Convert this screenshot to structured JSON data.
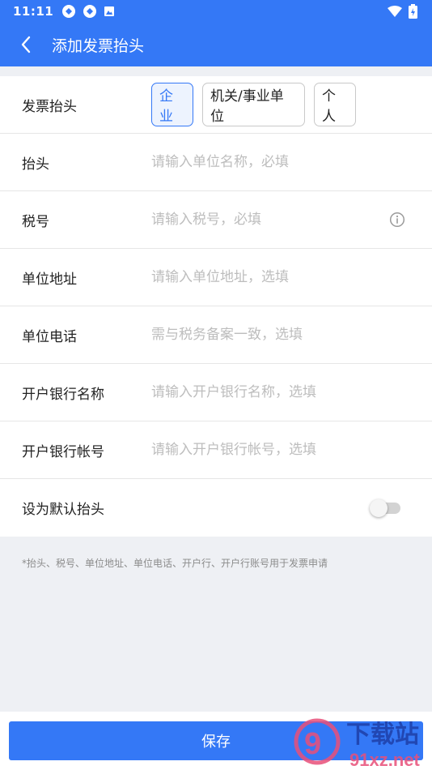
{
  "status_bar": {
    "time": "11:11"
  },
  "nav": {
    "title": "添加发票抬头"
  },
  "invoice_type": {
    "label": "发票抬头",
    "options": [
      "企业",
      "机关/事业单位",
      "个人"
    ],
    "selected": "企业"
  },
  "fields": {
    "title": {
      "label": "抬头",
      "placeholder": "请输入单位名称，必填"
    },
    "tax_no": {
      "label": "税号",
      "placeholder": "请输入税号，必填"
    },
    "address": {
      "label": "单位地址",
      "placeholder": "请输入单位地址，选填"
    },
    "phone": {
      "label": "单位电话",
      "placeholder": "需与税务备案一致，选填"
    },
    "bank_name": {
      "label": "开户银行名称",
      "placeholder": "请输入开户银行名称，选填"
    },
    "bank_account": {
      "label": "开户银行帐号",
      "placeholder": "请输入开户银行帐号，选填"
    }
  },
  "default_toggle": {
    "label": "设为默认抬头",
    "on": false
  },
  "note": "*抬头、税号、单位地址、单位电话、开户行、开户行账号用于发票申请",
  "save_label": "保存",
  "watermark": {
    "line1": "下载站",
    "line2": "91xz.net"
  },
  "colors": {
    "accent": "#3478f6",
    "background": "#eef0f4",
    "placeholder": "#bdbdbd"
  },
  "icons": [
    "back-arrow-icon",
    "info-icon",
    "wifi-icon",
    "battery-icon"
  ]
}
